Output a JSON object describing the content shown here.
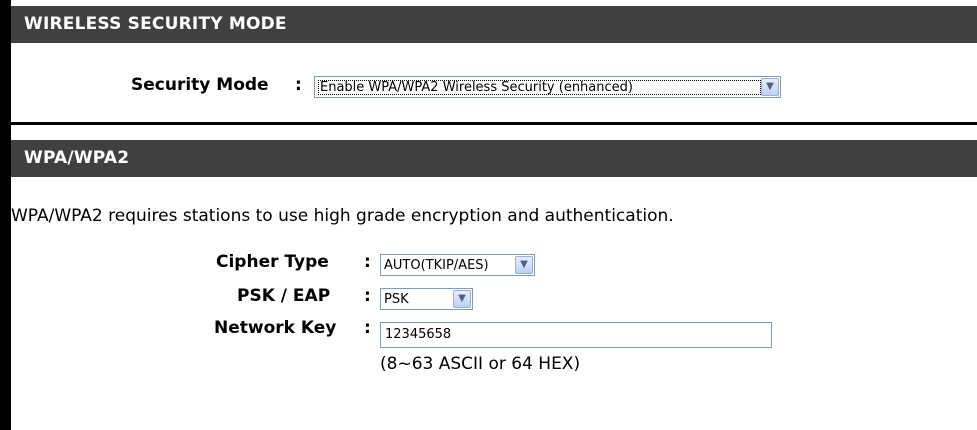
{
  "wireless_security": {
    "header": "WIRELESS SECURITY MODE",
    "security_mode_label": "Security Mode",
    "colon": ":",
    "security_mode_value": "Enable WPA/WPA2 Wireless Security (enhanced)"
  },
  "wpa": {
    "header": "WPA/WPA2",
    "description": "WPA/WPA2 requires stations to use high grade encryption and authentication.",
    "cipher_type_label": "Cipher Type",
    "cipher_type_value": "AUTO(TKIP/AES)",
    "psk_eap_label": "PSK / EAP",
    "psk_eap_value": "PSK",
    "network_key_label": "Network Key",
    "network_key_value": "12345658",
    "network_key_hint": "(8~63 ASCII or 64 HEX)",
    "colon": ":"
  },
  "icons": {
    "dropdown": "chevron-down-icon"
  },
  "colors": {
    "header_bg": "#404040",
    "header_text": "#ffffff",
    "field_border": "#7f9db9"
  }
}
